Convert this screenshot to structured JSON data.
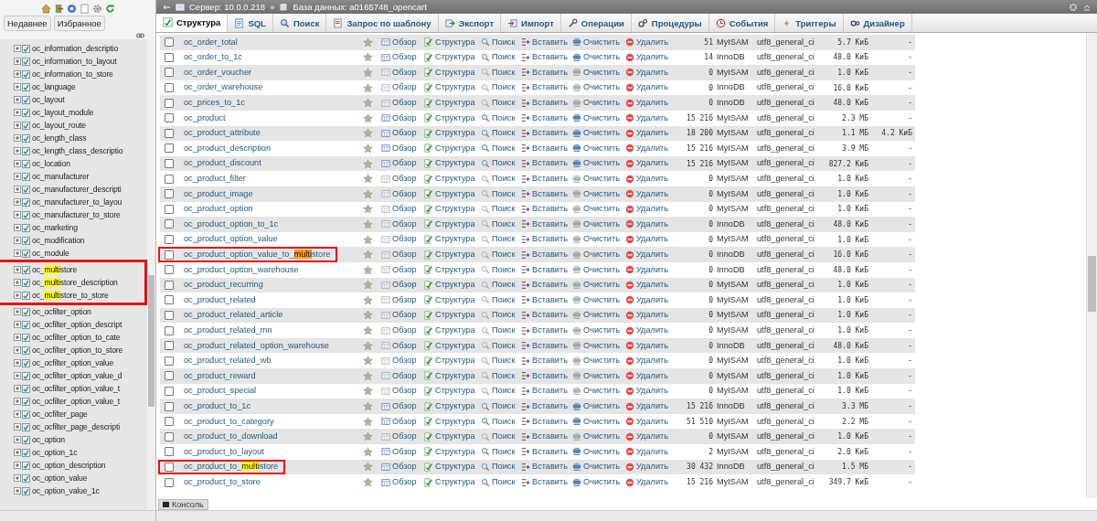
{
  "sidebar": {
    "buttons": [
      {
        "label": "Недавнее"
      },
      {
        "label": "Избранное"
      }
    ],
    "items": [
      {
        "name": "oc_information_descriptio",
        "outlined": false
      },
      {
        "name": "oc_information_to_layout",
        "outlined": false
      },
      {
        "name": "oc_information_to_store",
        "outlined": false
      },
      {
        "name": "oc_language",
        "outlined": false
      },
      {
        "name": "oc_layout",
        "outlined": false
      },
      {
        "name": "oc_layout_module",
        "outlined": false
      },
      {
        "name": "oc_layout_route",
        "outlined": false
      },
      {
        "name": "oc_length_class",
        "outlined": false
      },
      {
        "name": "oc_length_class_descriptio",
        "outlined": false
      },
      {
        "name": "oc_location",
        "outlined": false
      },
      {
        "name": "oc_manufacturer",
        "outlined": false
      },
      {
        "name": "oc_manufacturer_descripti",
        "outlined": false
      },
      {
        "name": "oc_manufacturer_to_layou",
        "outlined": false
      },
      {
        "name": "oc_manufacturer_to_store",
        "outlined": false
      },
      {
        "name": "oc_marketing",
        "outlined": false
      },
      {
        "name": "oc_modification",
        "outlined": false
      },
      {
        "name": "oc_module",
        "outlined": false
      },
      {
        "name": "oc_",
        "match": "multi",
        "suffix": "store",
        "outlined": true
      },
      {
        "name": "oc_",
        "match": "multi",
        "suffix": "store_description",
        "outlined": true
      },
      {
        "name": "oc_",
        "match": "multi",
        "suffix": "store_to_store",
        "outlined": true
      },
      {
        "name": "oc_ocfilter_option",
        "outlined": false
      },
      {
        "name": "oc_ocfilter_option_descript",
        "outlined": false
      },
      {
        "name": "oc_ocfilter_option_to_cate",
        "outlined": false
      },
      {
        "name": "oc_ocfilter_option_to_store",
        "outlined": false
      },
      {
        "name": "oc_ocfilter_option_value",
        "outlined": false
      },
      {
        "name": "oc_ocfilter_option_value_d",
        "outlined": false
      },
      {
        "name": "oc_ocfilter_option_value_t",
        "outlined": false
      },
      {
        "name": "oc_ocfilter_option_value_t",
        "outlined": false
      },
      {
        "name": "oc_ocfilter_page",
        "outlined": false
      },
      {
        "name": "oc_ocfilter_page_descripti",
        "outlined": false
      },
      {
        "name": "oc_option",
        "outlined": false
      },
      {
        "name": "oc_option_1c",
        "outlined": false
      },
      {
        "name": "oc_option_description",
        "outlined": false
      },
      {
        "name": "oc_option_value",
        "outlined": false
      },
      {
        "name": "oc_option_value_1c",
        "outlined": false
      }
    ]
  },
  "breadcrumb": {
    "server": "Сервер: 10.0.0.218",
    "separator": "»",
    "database": "База данных: a0165748_opencart"
  },
  "tabs": [
    {
      "label": "Структура",
      "kind": "structure",
      "selected": true
    },
    {
      "label": "SQL",
      "kind": "sql",
      "selected": false
    },
    {
      "label": "Поиск",
      "kind": "search",
      "selected": false
    },
    {
      "label": "Запрос по шаблону",
      "kind": "query",
      "selected": false
    },
    {
      "label": "Экспорт",
      "kind": "export",
      "selected": false
    },
    {
      "label": "Импорт",
      "kind": "import",
      "selected": false
    },
    {
      "label": "Операции",
      "kind": "operations",
      "selected": false
    },
    {
      "label": "Процедуры",
      "kind": "routines",
      "selected": false
    },
    {
      "label": "События",
      "kind": "events",
      "selected": false
    },
    {
      "label": "Триггеры",
      "kind": "triggers",
      "selected": false
    },
    {
      "label": "Дизайнер",
      "kind": "designer",
      "selected": false
    }
  ],
  "table": {
    "rows": [
      {
        "name": "oc_order_total",
        "checked": false,
        "has_rows": true,
        "outlined": false,
        "actions": [
          "Обзор",
          "Структура",
          "Поиск",
          "Вставить",
          "Очистить",
          "Удалить"
        ],
        "rows": "51",
        "engine": "MyISAM",
        "collation": "utf8_general_ci",
        "size": "5.7 КиБ",
        "overhead": "-"
      },
      {
        "name": "oc_order_to_1c",
        "checked": false,
        "has_rows": true,
        "outlined": false,
        "actions": [
          "Обзор",
          "Структура",
          "Поиск",
          "Вставить",
          "Очистить",
          "Удалить"
        ],
        "rows": "14",
        "engine": "InnoDB",
        "collation": "utf8_general_ci",
        "size": "48.0 КиБ",
        "overhead": "-"
      },
      {
        "name": "oc_order_voucher",
        "checked": false,
        "has_rows": false,
        "outlined": false,
        "actions": [
          "Обзор",
          "Структура",
          "Поиск",
          "Вставить",
          "Очистить",
          "Удалить"
        ],
        "rows": "0",
        "engine": "MyISAM",
        "collation": "utf8_general_ci",
        "size": "1.0 КиБ",
        "overhead": "-"
      },
      {
        "name": "oc_order_warehouse",
        "checked": false,
        "has_rows": false,
        "outlined": false,
        "actions": [
          "Обзор",
          "Структура",
          "Поиск",
          "Вставить",
          "Очистить",
          "Удалить"
        ],
        "rows": "0",
        "engine": "InnoDB",
        "collation": "utf8_general_ci",
        "size": "16.0 КиБ",
        "overhead": "-"
      },
      {
        "name": "oc_prices_to_1c",
        "checked": false,
        "has_rows": false,
        "outlined": false,
        "actions": [
          "Обзор",
          "Структура",
          "Поиск",
          "Вставить",
          "Очистить",
          "Удалить"
        ],
        "rows": "0",
        "engine": "InnoDB",
        "collation": "utf8_general_ci",
        "size": "48.0 КиБ",
        "overhead": "-"
      },
      {
        "name": "oc_product",
        "checked": false,
        "has_rows": true,
        "outlined": false,
        "actions": [
          "Обзор",
          "Структура",
          "Поиск",
          "Вставить",
          "Очистить",
          "Удалить"
        ],
        "rows": "15 216",
        "engine": "MyISAM",
        "collation": "utf8_general_ci",
        "size": "2.3 МБ",
        "overhead": "-"
      },
      {
        "name": "oc_product_attribute",
        "checked": false,
        "has_rows": true,
        "outlined": false,
        "actions": [
          "Обзор",
          "Структура",
          "Поиск",
          "Вставить",
          "Очистить",
          "Удалить"
        ],
        "rows": "18 200",
        "engine": "MyISAM",
        "collation": "utf8_general_ci",
        "size": "1.1 МБ",
        "overhead": "4.2 КиБ"
      },
      {
        "name": "oc_product_description",
        "checked": false,
        "has_rows": true,
        "outlined": false,
        "actions": [
          "Обзор",
          "Структура",
          "Поиск",
          "Вставить",
          "Очистить",
          "Удалить"
        ],
        "rows": "15 216",
        "engine": "MyISAM",
        "collation": "utf8_general_ci",
        "size": "3.9 МБ",
        "overhead": "-"
      },
      {
        "name": "oc_product_discount",
        "checked": false,
        "has_rows": true,
        "outlined": false,
        "actions": [
          "Обзор",
          "Структура",
          "Поиск",
          "Вставить",
          "Очистить",
          "Удалить"
        ],
        "rows": "15 216",
        "engine": "MyISAM",
        "collation": "utf8_general_ci",
        "size": "827.2 КиБ",
        "overhead": "-"
      },
      {
        "name": "oc_product_filter",
        "checked": false,
        "has_rows": false,
        "outlined": false,
        "actions": [
          "Обзор",
          "Структура",
          "Поиск",
          "Вставить",
          "Очистить",
          "Удалить"
        ],
        "rows": "0",
        "engine": "MyISAM",
        "collation": "utf8_general_ci",
        "size": "1.0 КиБ",
        "overhead": "-"
      },
      {
        "name": "oc_product_image",
        "checked": false,
        "has_rows": false,
        "outlined": false,
        "actions": [
          "Обзор",
          "Структура",
          "Поиск",
          "Вставить",
          "Очистить",
          "Удалить"
        ],
        "rows": "0",
        "engine": "MyISAM",
        "collation": "utf8_general_ci",
        "size": "1.0 КиБ",
        "overhead": "-"
      },
      {
        "name": "oc_product_option",
        "checked": false,
        "has_rows": false,
        "outlined": false,
        "actions": [
          "Обзор",
          "Структура",
          "Поиск",
          "Вставить",
          "Очистить",
          "Удалить"
        ],
        "rows": "0",
        "engine": "MyISAM",
        "collation": "utf8_general_ci",
        "size": "1.0 КиБ",
        "overhead": "-"
      },
      {
        "name": "oc_product_option_to_1c",
        "checked": false,
        "has_rows": false,
        "outlined": false,
        "actions": [
          "Обзор",
          "Структура",
          "Поиск",
          "Вставить",
          "Очистить",
          "Удалить"
        ],
        "rows": "0",
        "engine": "InnoDB",
        "collation": "utf8_general_ci",
        "size": "48.0 КиБ",
        "overhead": "-"
      },
      {
        "name": "oc_product_option_value",
        "checked": false,
        "has_rows": false,
        "outlined": false,
        "actions": [
          "Обзор",
          "Структура",
          "Поиск",
          "Вставить",
          "Очистить",
          "Удалить"
        ],
        "rows": "0",
        "engine": "MyISAM",
        "collation": "utf8_general_ci",
        "size": "1.0 КиБ",
        "overhead": "-"
      },
      {
        "name": "oc_product_option_value_to_",
        "checked": false,
        "match": "multi",
        "suffix": "store",
        "match_current": true,
        "has_rows": false,
        "outlined": true,
        "actions": [
          "Обзор",
          "Структура",
          "Поиск",
          "Вставить",
          "Очистить",
          "Удалить"
        ],
        "rows": "0",
        "engine": "InnoDB",
        "collation": "utf8_general_ci",
        "size": "16.0 КиБ",
        "overhead": "-"
      },
      {
        "name": "oc_product_option_warehouse",
        "checked": false,
        "has_rows": false,
        "outlined": false,
        "actions": [
          "Обзор",
          "Структура",
          "Поиск",
          "Вставить",
          "Очистить",
          "Удалить"
        ],
        "rows": "0",
        "engine": "InnoDB",
        "collation": "utf8_general_ci",
        "size": "48.0 КиБ",
        "overhead": "-"
      },
      {
        "name": "oc_product_recurring",
        "checked": false,
        "has_rows": false,
        "outlined": false,
        "actions": [
          "Обзор",
          "Структура",
          "Поиск",
          "Вставить",
          "Очистить",
          "Удалить"
        ],
        "rows": "0",
        "engine": "MyISAM",
        "collation": "utf8_general_ci",
        "size": "1.0 КиБ",
        "overhead": "-"
      },
      {
        "name": "oc_product_related",
        "checked": false,
        "has_rows": false,
        "outlined": false,
        "actions": [
          "Обзор",
          "Структура",
          "Поиск",
          "Вставить",
          "Очистить",
          "Удалить"
        ],
        "rows": "0",
        "engine": "MyISAM",
        "collation": "utf8_general_ci",
        "size": "1.0 КиБ",
        "overhead": "-"
      },
      {
        "name": "oc_product_related_article",
        "checked": false,
        "has_rows": false,
        "outlined": false,
        "actions": [
          "Обзор",
          "Структура",
          "Поиск",
          "Вставить",
          "Очистить",
          "Удалить"
        ],
        "rows": "0",
        "engine": "MyISAM",
        "collation": "utf8_general_ci",
        "size": "1.0 КиБ",
        "overhead": "-"
      },
      {
        "name": "oc_product_related_mn",
        "checked": false,
        "has_rows": false,
        "outlined": false,
        "actions": [
          "Обзор",
          "Структура",
          "Поиск",
          "Вставить",
          "Очистить",
          "Удалить"
        ],
        "rows": "0",
        "engine": "MyISAM",
        "collation": "utf8_general_ci",
        "size": "1.0 КиБ",
        "overhead": "-"
      },
      {
        "name": "oc_product_related_option_warehouse",
        "checked": false,
        "has_rows": false,
        "outlined": false,
        "actions": [
          "Обзор",
          "Структура",
          "Поиск",
          "Вставить",
          "Очистить",
          "Удалить"
        ],
        "rows": "0",
        "engine": "InnoDB",
        "collation": "utf8_general_ci",
        "size": "48.0 КиБ",
        "overhead": "-"
      },
      {
        "name": "oc_product_related_wb",
        "checked": false,
        "has_rows": false,
        "outlined": false,
        "actions": [
          "Обзор",
          "Структура",
          "Поиск",
          "Вставить",
          "Очистить",
          "Удалить"
        ],
        "rows": "0",
        "engine": "MyISAM",
        "collation": "utf8_general_ci",
        "size": "1.0 КиБ",
        "overhead": "-"
      },
      {
        "name": "oc_product_reward",
        "checked": false,
        "has_rows": false,
        "outlined": false,
        "actions": [
          "Обзор",
          "Структура",
          "Поиск",
          "Вставить",
          "Очистить",
          "Удалить"
        ],
        "rows": "0",
        "engine": "MyISAM",
        "collation": "utf8_general_ci",
        "size": "1.0 КиБ",
        "overhead": "-"
      },
      {
        "name": "oc_product_special",
        "checked": false,
        "has_rows": false,
        "outlined": false,
        "actions": [
          "Обзор",
          "Структура",
          "Поиск",
          "Вставить",
          "Очистить",
          "Удалить"
        ],
        "rows": "0",
        "engine": "MyISAM",
        "collation": "utf8_general_ci",
        "size": "1.0 КиБ",
        "overhead": "-"
      },
      {
        "name": "oc_product_to_1c",
        "checked": false,
        "has_rows": true,
        "outlined": false,
        "actions": [
          "Обзор",
          "Структура",
          "Поиск",
          "Вставить",
          "Очистить",
          "Удалить"
        ],
        "rows": "15 216",
        "engine": "InnoDB",
        "collation": "utf8_general_ci",
        "size": "3.3 МБ",
        "overhead": "-"
      },
      {
        "name": "oc_product_to_category",
        "checked": false,
        "has_rows": true,
        "outlined": false,
        "actions": [
          "Обзор",
          "Структура",
          "Поиск",
          "Вставить",
          "Очистить",
          "Удалить"
        ],
        "rows": "51 510",
        "engine": "MyISAM",
        "collation": "utf8_general_ci",
        "size": "2.2 МБ",
        "overhead": "-"
      },
      {
        "name": "oc_product_to_download",
        "checked": false,
        "has_rows": false,
        "outlined": false,
        "actions": [
          "Обзор",
          "Структура",
          "Поиск",
          "Вставить",
          "Очистить",
          "Удалить"
        ],
        "rows": "0",
        "engine": "MyISAM",
        "collation": "utf8_general_ci",
        "size": "1.0 КиБ",
        "overhead": "-"
      },
      {
        "name": "oc_product_to_layout",
        "checked": false,
        "has_rows": true,
        "outlined": false,
        "actions": [
          "Обзор",
          "Структура",
          "Поиск",
          "Вставить",
          "Очистить",
          "Удалить"
        ],
        "rows": "2",
        "engine": "MyISAM",
        "collation": "utf8_general_ci",
        "size": "2.0 КиБ",
        "overhead": "-"
      },
      {
        "name": "oc_product_to_",
        "checked": false,
        "match": "multi",
        "suffix": "store",
        "match_current": false,
        "has_rows": true,
        "outlined": true,
        "actions": [
          "Обзор",
          "Структура",
          "Поиск",
          "Вставить",
          "Очистить",
          "Удалить"
        ],
        "rows": "30 432",
        "engine": "InnoDB",
        "collation": "utf8_general_ci",
        "size": "1.5 МБ",
        "overhead": "-"
      },
      {
        "name": "oc_product_to_store",
        "checked": false,
        "has_rows": true,
        "outlined": false,
        "actions": [
          "Обзор",
          "Структура",
          "Поиск",
          "Вставить",
          "Очистить",
          "Удалить"
        ],
        "rows": "15 216",
        "engine": "MyISAM",
        "collation": "utf8_general_ci",
        "size": "349.7 КиБ",
        "overhead": "-"
      }
    ]
  },
  "console": {
    "label": "Консоль"
  }
}
